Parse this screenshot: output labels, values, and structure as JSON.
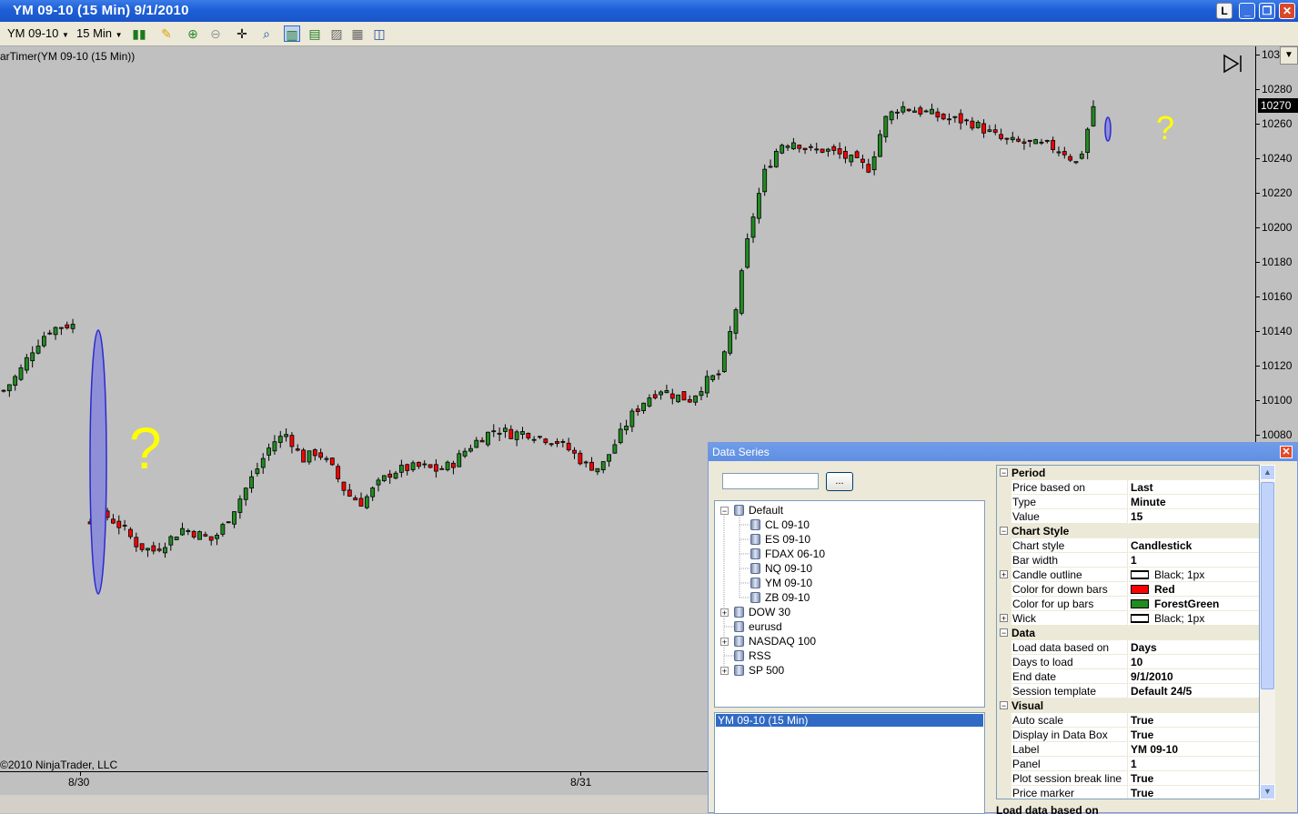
{
  "window": {
    "title": "YM 09-10 (15 Min)  9/1/2010",
    "buttons": {
      "layout": "L",
      "minimize": "_",
      "restore": "❐",
      "close": "✕"
    }
  },
  "toolbar": {
    "instrument": "YM 09-10",
    "interval": "15 Min",
    "icons": [
      "bar-type-icon",
      "draw-tool-icon",
      "zoom-in-icon",
      "zoom-out-icon",
      "crosshair-icon",
      "magnifier-icon",
      "data-series-icon",
      "indicators-icon",
      "strategies-icon",
      "properties-icon",
      "panel-icon"
    ]
  },
  "chart": {
    "indicator_label": "arTimer(YM 09-10 (15 Min))",
    "copyright": "©2010 NinjaTrader, LLC",
    "annotations": [
      "?",
      "?"
    ],
    "current_price": "10270",
    "colors": {
      "up": "#228b22",
      "down": "#ff0000",
      "background": "#c0c0c0",
      "ellipse": "#6a6ad0"
    }
  },
  "chart_data": {
    "type": "candlestick",
    "title": "",
    "x_ticks": [
      "8/30",
      "8/31"
    ],
    "y_ticks": [
      "103",
      "10280",
      "10260",
      "10240",
      "10220",
      "10200",
      "10180",
      "10160",
      "10140",
      "10120",
      "10100",
      "10080"
    ],
    "ylim": [
      10074,
      10290
    ],
    "approx_close_path": [
      10105,
      10115,
      10130,
      10140,
      10143,
      null,
      10030,
      10032,
      10025,
      10015,
      10012,
      10018,
      10025,
      10022,
      10018,
      10030,
      10045,
      10060,
      10075,
      10080,
      10065,
      10070,
      10060,
      10045,
      10040,
      10050,
      10058,
      10060,
      10061,
      10059,
      10062,
      10071,
      10078,
      10083,
      10080,
      10081,
      10078,
      10076,
      10070,
      10062,
      10060,
      10075,
      10090,
      10100,
      10106,
      10102,
      10100,
      10110,
      10115,
      10150,
      10200,
      10232,
      10248,
      10250,
      10244,
      10245,
      10242,
      10238,
      10234,
      10262,
      10270,
      10268,
      10266,
      10263,
      10262,
      10260,
      10255,
      10250,
      10249,
      10248,
      10247,
      10244,
      10236,
      10270
    ],
    "grid": false
  },
  "dialog": {
    "title": "Data Series",
    "close": "✕",
    "search_value": "",
    "browse_label": "...",
    "tree": [
      {
        "label": "Default",
        "expanded": true,
        "children": [
          "CL 09-10",
          "ES 09-10",
          "FDAX 06-10",
          "NQ 09-10",
          "YM 09-10",
          "ZB 09-10"
        ]
      },
      {
        "label": "DOW 30",
        "expanded": false
      },
      {
        "label": "eurusd",
        "expanded": null
      },
      {
        "label": "NASDAQ 100",
        "expanded": false
      },
      {
        "label": "RSS",
        "expanded": null
      },
      {
        "label": "SP 500",
        "expanded": false
      }
    ],
    "selected_series": "YM 09-10 (15 Min)",
    "properties": [
      {
        "cat": "Period"
      },
      {
        "name": "Price based on",
        "value": "Last"
      },
      {
        "name": "Type",
        "value": "Minute"
      },
      {
        "name": "Value",
        "value": "15"
      },
      {
        "cat": "Chart Style"
      },
      {
        "name": "Chart style",
        "value": "Candlestick"
      },
      {
        "name": "Bar width",
        "value": "1"
      },
      {
        "name": "Candle outline",
        "value": "Black; 1px",
        "swatch": "#ffffff",
        "expandable": true,
        "normal": true
      },
      {
        "name": "Color for down bars",
        "value": "Red",
        "swatch": "#ff0000"
      },
      {
        "name": "Color for up bars",
        "value": "ForestGreen",
        "swatch": "#228b22"
      },
      {
        "name": "Wick",
        "value": "Black; 1px",
        "swatch": "#ffffff",
        "expandable": true,
        "normal": true
      },
      {
        "cat": "Data"
      },
      {
        "name": "Load data based on",
        "value": "Days"
      },
      {
        "name": "Days to load",
        "value": "10"
      },
      {
        "name": "End date",
        "value": "9/1/2010"
      },
      {
        "name": "Session template",
        "value": "Default 24/5"
      },
      {
        "cat": "Visual"
      },
      {
        "name": "Auto scale",
        "value": "True"
      },
      {
        "name": "Display in Data Box",
        "value": "True"
      },
      {
        "name": "Label",
        "value": "YM 09-10"
      },
      {
        "name": "Panel",
        "value": "1"
      },
      {
        "name": "Plot session break line",
        "value": "True"
      },
      {
        "name": "Price marker",
        "value": "True"
      }
    ],
    "description_title": "Load data based on"
  }
}
